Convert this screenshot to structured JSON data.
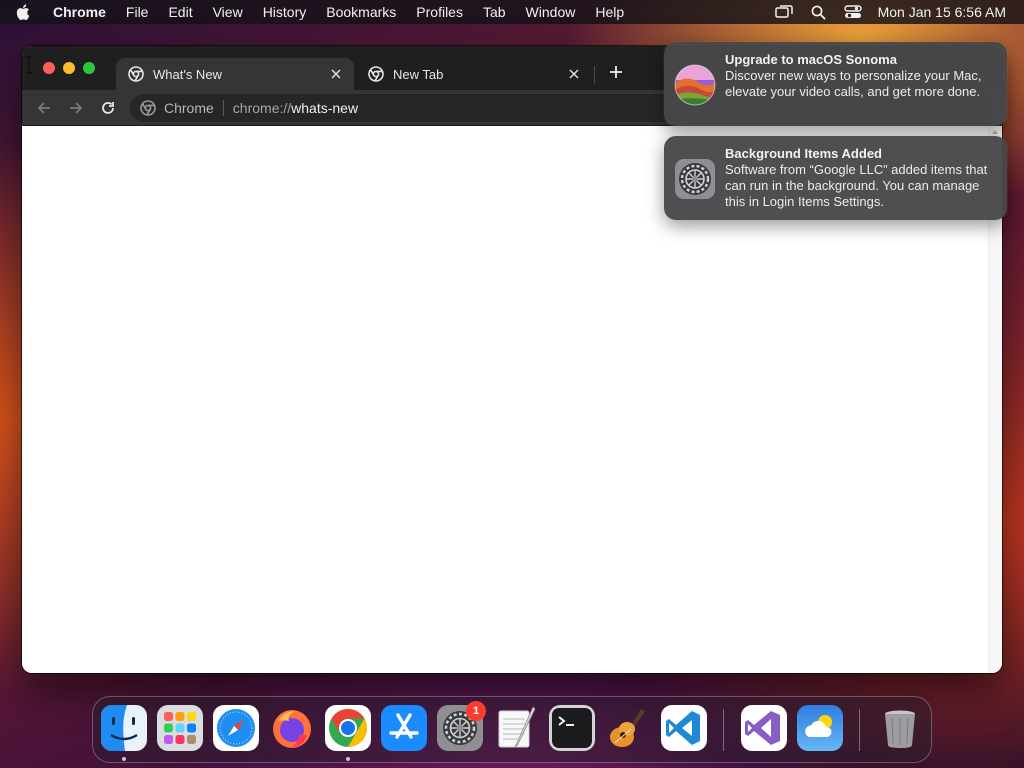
{
  "menubar": {
    "app_name": "Chrome",
    "items": [
      "File",
      "Edit",
      "View",
      "History",
      "Bookmarks",
      "Profiles",
      "Tab",
      "Window",
      "Help"
    ],
    "clock": "Mon Jan 15  6:56 AM"
  },
  "browser": {
    "tabs": [
      {
        "title": "What's New",
        "active": true
      },
      {
        "title": "New Tab",
        "active": false
      }
    ],
    "omnibox": {
      "chip": "Chrome",
      "url_scheme": "chrome://",
      "url_path": "whats-new"
    }
  },
  "notifications": [
    {
      "title": "Upgrade to macOS Sonoma",
      "body": "Discover new ways to personalize your Mac, elevate your video calls, and get more done.",
      "icon": "macos-sonoma-icon"
    },
    {
      "title": "Background Items Added",
      "body": "Software from “Google LLC” added items that can run in the background. You can manage this in Login Items Settings.",
      "icon": "system-settings-icon"
    }
  ],
  "dock": {
    "apps": [
      "finder",
      "launchpad",
      "safari",
      "firefox",
      "chrome",
      "app-store",
      "system-settings",
      "textedit",
      "terminal",
      "garageband",
      "vscode",
      "visual-studio",
      "weather",
      "trash"
    ],
    "system_settings_badge": "1"
  },
  "colors": {
    "tabstrip": "#1f1f1f",
    "toolbar": "#353535",
    "traffic_close": "#ff5f57",
    "traffic_min": "#febc2e",
    "traffic_max": "#28c840",
    "badge": "#ff3b30"
  }
}
